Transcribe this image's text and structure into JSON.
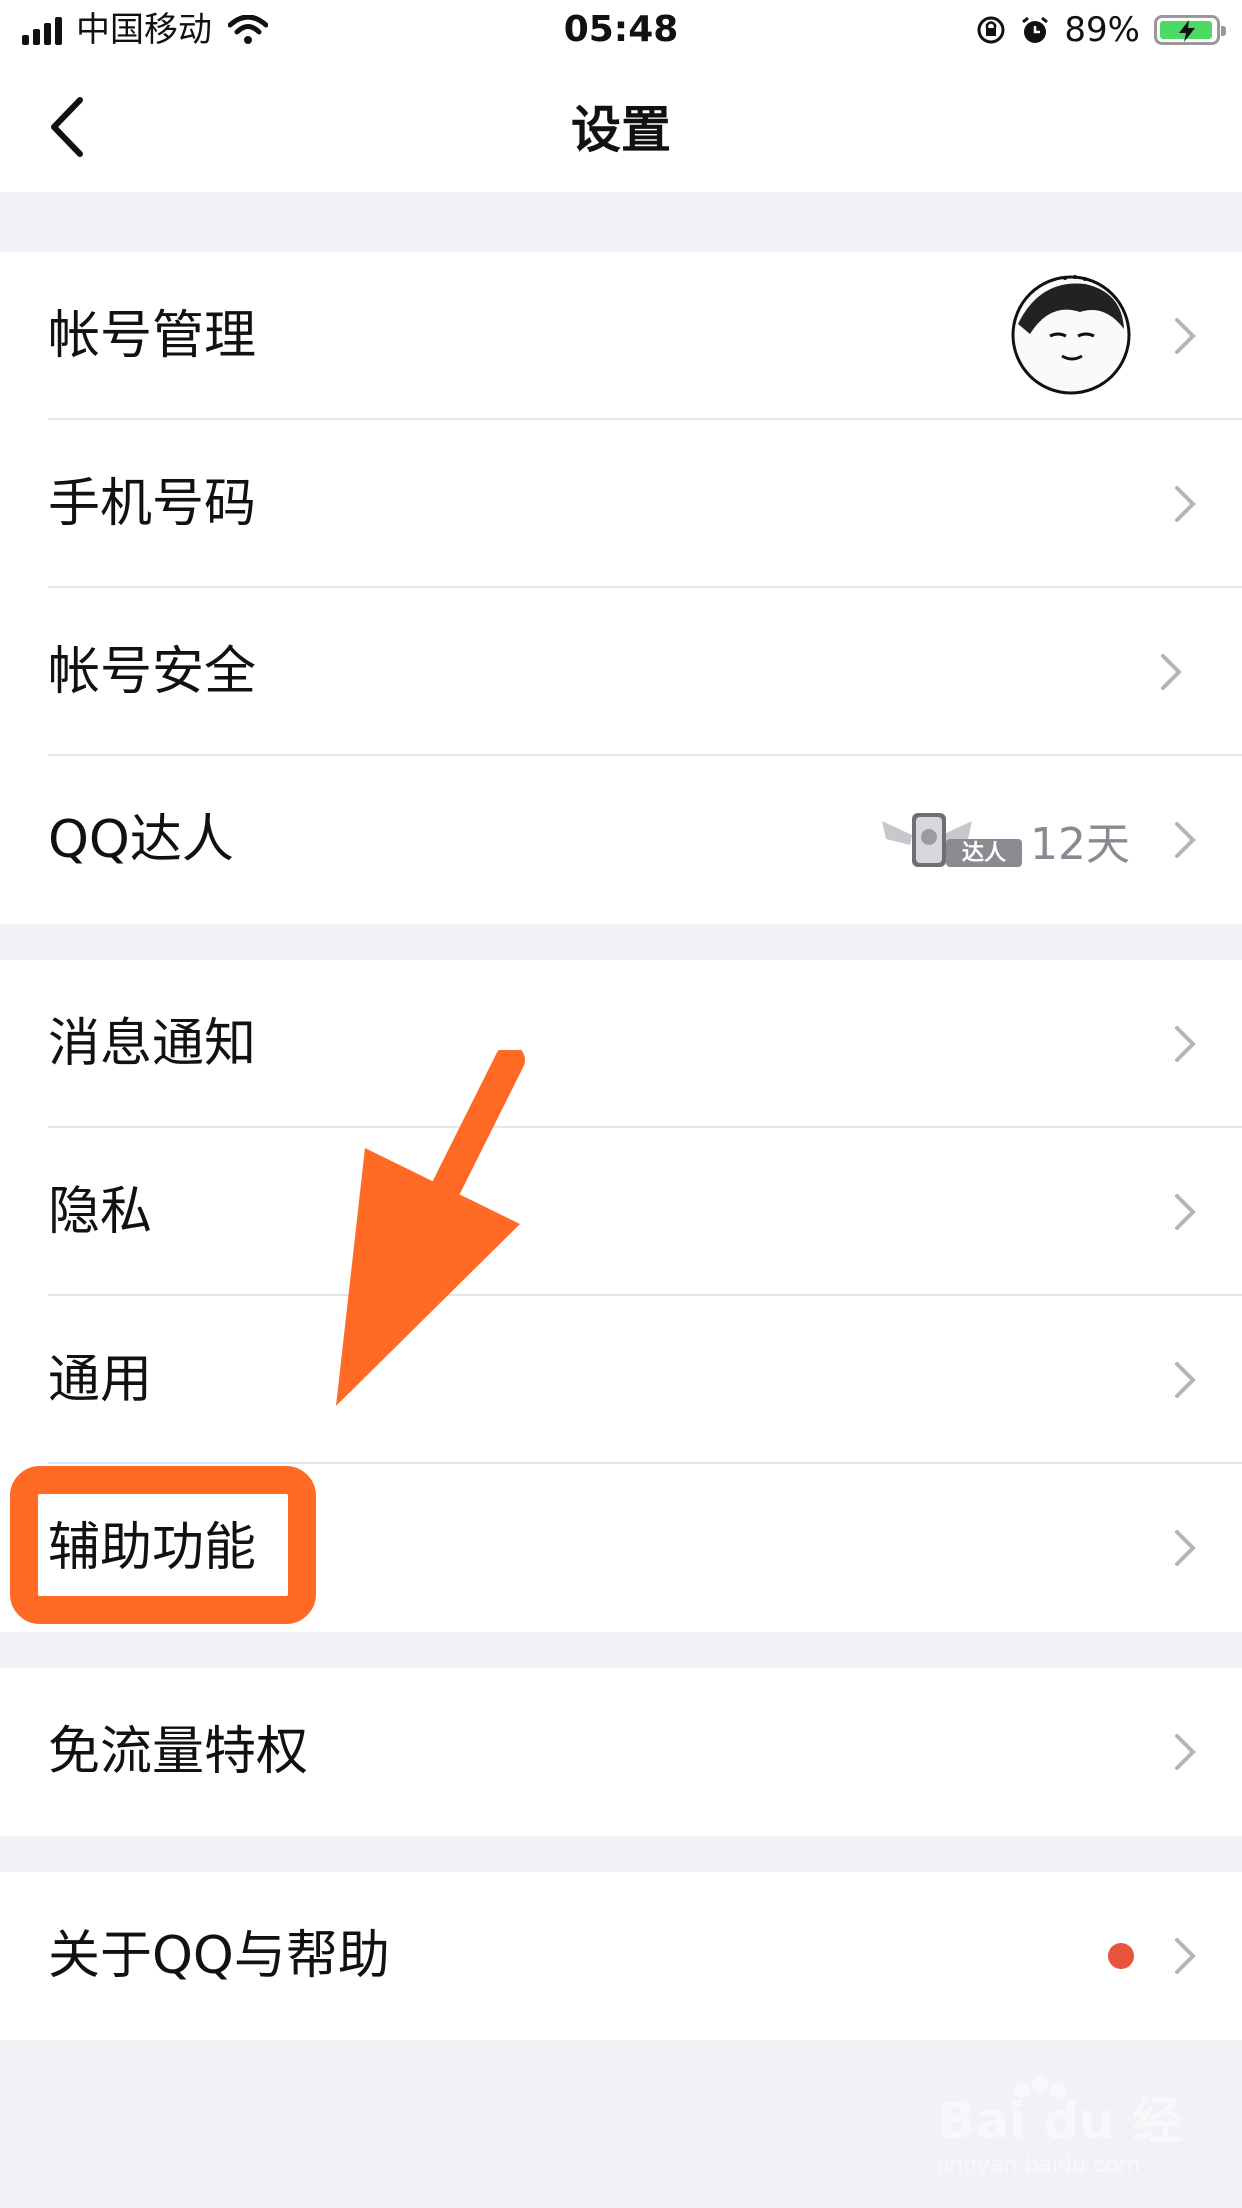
{
  "status_bar": {
    "carrier": "中国移动",
    "time": "05:48",
    "battery_percent": "89%"
  },
  "nav": {
    "title": "设置"
  },
  "groups": [
    {
      "items": [
        {
          "label": "帐号管理"
        },
        {
          "label": "手机号码"
        },
        {
          "label": "帐号安全"
        },
        {
          "label": "QQ达人",
          "badge_text": "达人",
          "detail": "12天"
        }
      ]
    },
    {
      "items": [
        {
          "label": "消息通知"
        },
        {
          "label": "隐私"
        },
        {
          "label": "通用"
        },
        {
          "label": "辅助功能"
        }
      ]
    },
    {
      "items": [
        {
          "label": "免流量特权"
        }
      ]
    },
    {
      "items": [
        {
          "label": "关于QQ与帮助"
        }
      ]
    }
  ],
  "watermark": {
    "brand": "Bai du 经验",
    "url": "jingyan.baidu.com"
  },
  "colors": {
    "highlight": "#ff6b24",
    "notification_dot": "#e8543b",
    "battery": "#4cd964"
  }
}
